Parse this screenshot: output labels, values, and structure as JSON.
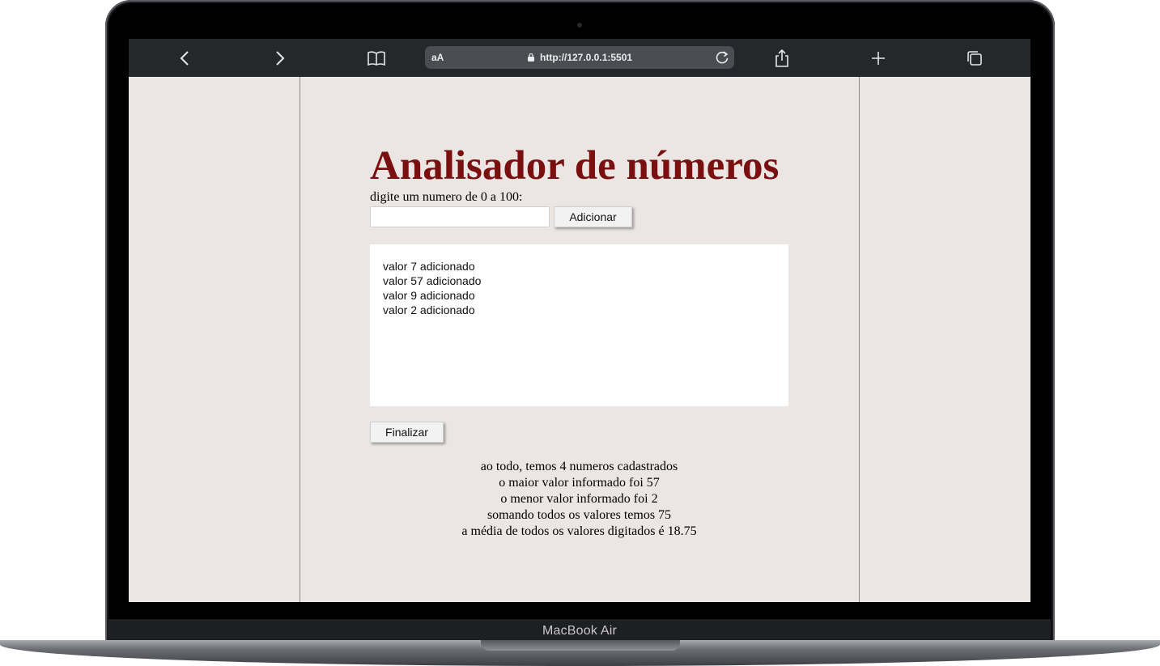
{
  "device": {
    "model_label": "MacBook Air"
  },
  "browser": {
    "text_size_label": "aA",
    "url": "http://127.0.0.1:5501"
  },
  "app": {
    "title": "Analisador de números",
    "prompt": "digite um numero de 0 a 100:",
    "input_value": "",
    "add_button": "Adicionar",
    "list": [
      "valor 7 adicionado",
      "valor 57 adicionado",
      "valor 9 adicionado",
      "valor 2 adicionado"
    ],
    "finish_button": "Finalizar",
    "results": [
      "ao todo, temos 4 numeros cadastrados",
      "o maior valor informado foi 57",
      "o menor valor informado foi 2",
      "somando todos os valores temos 75",
      "a média de todos os valores digitados é 18.75"
    ]
  },
  "colors": {
    "title": "#7a0f0f",
    "page_background": "#ebe6e3",
    "toolbar": "#25282b"
  }
}
